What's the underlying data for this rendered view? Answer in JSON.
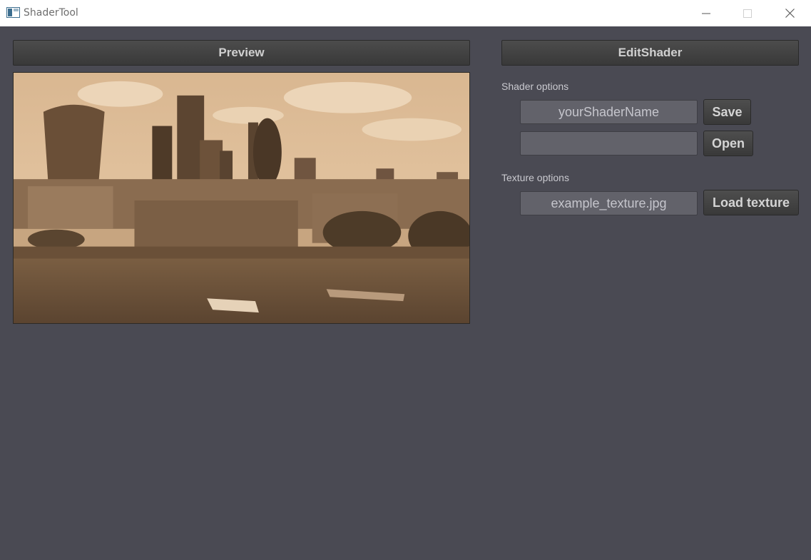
{
  "window": {
    "title": "ShaderTool",
    "icon": "app-window-icon",
    "controls": [
      "minimize-icon",
      "maximize-icon",
      "close-icon"
    ]
  },
  "preview": {
    "button_label": "Preview",
    "image": "city-skyline-river-sepia"
  },
  "editor": {
    "button_label": "EditShader",
    "shader_options_label": "Shader options",
    "shader_name_value": "yourShaderName",
    "shader_path_value": "",
    "save_label": "Save",
    "open_label": "Open",
    "texture_options_label": "Texture options",
    "texture_value": "example_texture.jpg",
    "load_texture_label": "Load texture"
  },
  "colors": {
    "background": "#4a4a53",
    "button": "#424242",
    "field": "#62626a",
    "sepia_tint": "#c7a580"
  }
}
